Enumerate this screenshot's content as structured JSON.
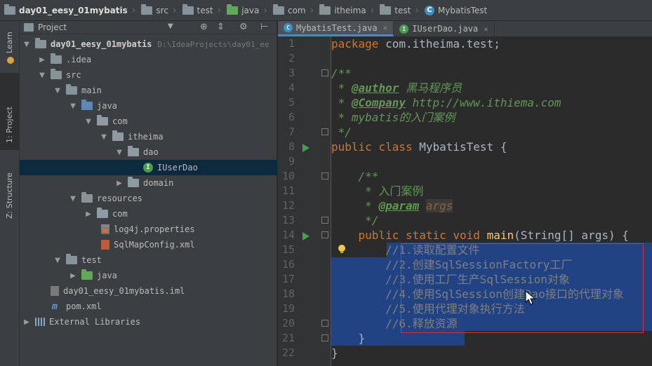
{
  "breadcrumb": [
    {
      "label": "day01_eesy_01mybatis",
      "icon": "folder-icon"
    },
    {
      "label": "src",
      "icon": "folder-icon"
    },
    {
      "label": "test",
      "icon": "folder-icon"
    },
    {
      "label": "java",
      "icon": "source-folder-icon"
    },
    {
      "label": "com",
      "icon": "package-icon"
    },
    {
      "label": "itheima",
      "icon": "package-icon"
    },
    {
      "label": "test",
      "icon": "package-icon"
    },
    {
      "label": "MybatisTest",
      "icon": "class-icon"
    }
  ],
  "tool_strip": {
    "learn": "Learn",
    "project": "1: Project",
    "structure": "Z: Structure"
  },
  "project_panel": {
    "title": "Project",
    "tree": [
      {
        "label": "day01_eesy_01mybatis",
        "hint": "D:\\IdeaProjects\\day01_ee",
        "depth": 0,
        "expanded": true,
        "icon": "module-icon"
      },
      {
        "label": ".idea",
        "depth": 1,
        "expanded": false,
        "icon": "folder-icon"
      },
      {
        "label": "src",
        "depth": 1,
        "expanded": true,
        "icon": "folder-icon"
      },
      {
        "label": "main",
        "depth": 2,
        "expanded": true,
        "icon": "folder-icon"
      },
      {
        "label": "java",
        "depth": 3,
        "expanded": true,
        "icon": "source-folder-icon"
      },
      {
        "label": "com",
        "depth": 4,
        "expanded": true,
        "icon": "package-icon"
      },
      {
        "label": "itheima",
        "depth": 5,
        "expanded": true,
        "icon": "package-icon"
      },
      {
        "label": "dao",
        "depth": 6,
        "expanded": true,
        "icon": "package-icon"
      },
      {
        "label": "IUserDao",
        "depth": 7,
        "selected": true,
        "icon": "interface-icon"
      },
      {
        "label": "domain",
        "depth": 6,
        "expanded": false,
        "icon": "package-icon"
      },
      {
        "label": "resources",
        "depth": 3,
        "expanded": true,
        "icon": "resources-folder-icon"
      },
      {
        "label": "com",
        "depth": 4,
        "expanded": false,
        "icon": "package-icon"
      },
      {
        "label": "log4j.properties",
        "depth": 5,
        "icon": "properties-file-icon"
      },
      {
        "label": "SqlMapConfig.xml",
        "depth": 5,
        "icon": "xml-file-icon"
      },
      {
        "label": "test",
        "depth": 2,
        "expanded": true,
        "icon": "test-folder-icon"
      },
      {
        "label": "java",
        "depth": 3,
        "expanded": false,
        "icon": "test-source-folder-icon"
      },
      {
        "label": "day01_eesy_01mybatis.iml",
        "depth": 1,
        "icon": "iml-file-icon"
      },
      {
        "label": "pom.xml",
        "depth": 1,
        "icon": "maven-icon"
      },
      {
        "label": "External Libraries",
        "depth": 0,
        "expanded": false,
        "icon": "library-icon"
      }
    ]
  },
  "editor": {
    "tabs": [
      {
        "label": "MybatisTest.java",
        "active": true,
        "icon": "class-icon"
      },
      {
        "label": "IUserDao.java",
        "active": false,
        "icon": "interface-icon"
      }
    ],
    "line_numbers": [
      "1",
      "2",
      "3",
      "4",
      "5",
      "6",
      "7",
      "8",
      "9",
      "10",
      "11",
      "12",
      "13",
      "14",
      "15",
      "16",
      "17",
      "18",
      "19",
      "20",
      "21",
      "22"
    ],
    "code": {
      "l1_kw": "package",
      "l1_rest": " com.itheima.test;",
      "l3": "/**",
      "l4_star": " * ",
      "l4_tag": "@author",
      "l4_rest": " 黑马程序员",
      "l5_star": " * ",
      "l5_tag": "@Company",
      "l5_rest": " http://www.ithiema.com",
      "l6": " * mybatis的入门案例",
      "l7": " */",
      "l8_kw": "public class",
      "l8_rest": " MybatisTest {",
      "l10": "    /**",
      "l11": "     * 入门案例",
      "l12_star": "     * ",
      "l12_tag": "@param",
      "l12_arg": "args",
      "l13": "     */",
      "l14_kw": "    public static void ",
      "l14_fn": "main",
      "l14_rest": "(String[] args) {",
      "l15": "        //1.读取配置文件",
      "l16": "        //2.创建SqlSessionFactory工厂",
      "l17": "        //3.使用工厂生产SqlSession对象",
      "l18": "        //4.使用SqlSession创建Dao接口的代理对象",
      "l19": "        //5.使用代理对象执行方法",
      "l20": "        //6.释放资源",
      "l21": "    }",
      "l22": "}"
    }
  },
  "colors": {
    "keyword": "#cc7832",
    "doc_comment": "#629755",
    "line_comment": "#808080",
    "selection": "#214283",
    "annotation_box": "#e0302a"
  }
}
